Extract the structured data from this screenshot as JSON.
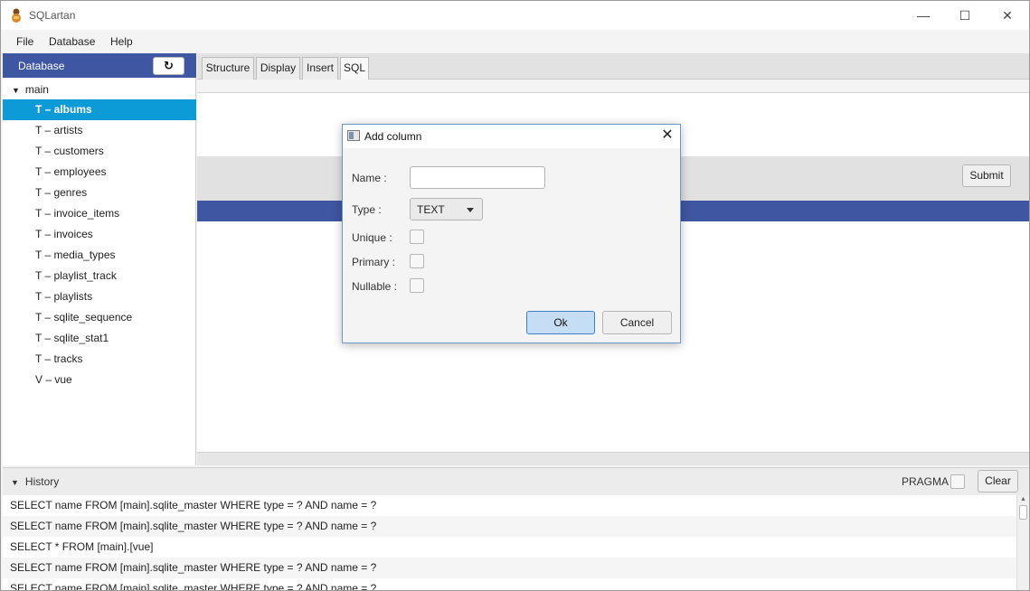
{
  "window": {
    "title": "SQLartan",
    "controls": {
      "minimize": "—",
      "maximize": "☐",
      "close": "✕"
    }
  },
  "menu": [
    "File",
    "Database",
    "Help"
  ],
  "sidebar": {
    "title": "Database",
    "refresh_icon": "refresh-icon",
    "root": "main",
    "items": [
      {
        "label": "T – albums",
        "selected": true
      },
      {
        "label": "T – artists"
      },
      {
        "label": "T – customers"
      },
      {
        "label": "T – employees"
      },
      {
        "label": "T – genres"
      },
      {
        "label": "T – invoice_items"
      },
      {
        "label": "T – invoices"
      },
      {
        "label": "T – media_types"
      },
      {
        "label": "T – playlist_track"
      },
      {
        "label": "T – playlists"
      },
      {
        "label": "T – sqlite_sequence"
      },
      {
        "label": "T – sqlite_stat1"
      },
      {
        "label": "T – tracks"
      },
      {
        "label": "V – vue"
      }
    ]
  },
  "tabs": [
    {
      "label": "Structure"
    },
    {
      "label": "Display"
    },
    {
      "label": "Insert"
    },
    {
      "label": "SQL",
      "active": true
    }
  ],
  "main": {
    "submit_label": "Submit"
  },
  "history": {
    "title": "History",
    "pragma_label": "PRAGMA",
    "clear_label": "Clear",
    "rows": [
      "SELECT name FROM [main].sqlite_master WHERE type = ? AND name = ?",
      "SELECT name FROM [main].sqlite_master WHERE type = ? AND name = ?",
      "SELECT * FROM [main].[vue]",
      "SELECT name FROM [main].sqlite_master WHERE type = ? AND name = ?",
      "SELECT name FROM [main].sqlite_master WHERE type = ? AND name = ?"
    ]
  },
  "dialog": {
    "title": "Add column",
    "name_label": "Name :",
    "name_value": "",
    "type_label": "Type :",
    "type_value": "TEXT",
    "unique_label": "Unique :",
    "primary_label": "Primary :",
    "nullable_label": "Nullable :",
    "ok_label": "Ok",
    "cancel_label": "Cancel"
  },
  "colors": {
    "accent": "#3f56a3",
    "selection": "#0d9bd8",
    "default_button": "#c6def5"
  }
}
